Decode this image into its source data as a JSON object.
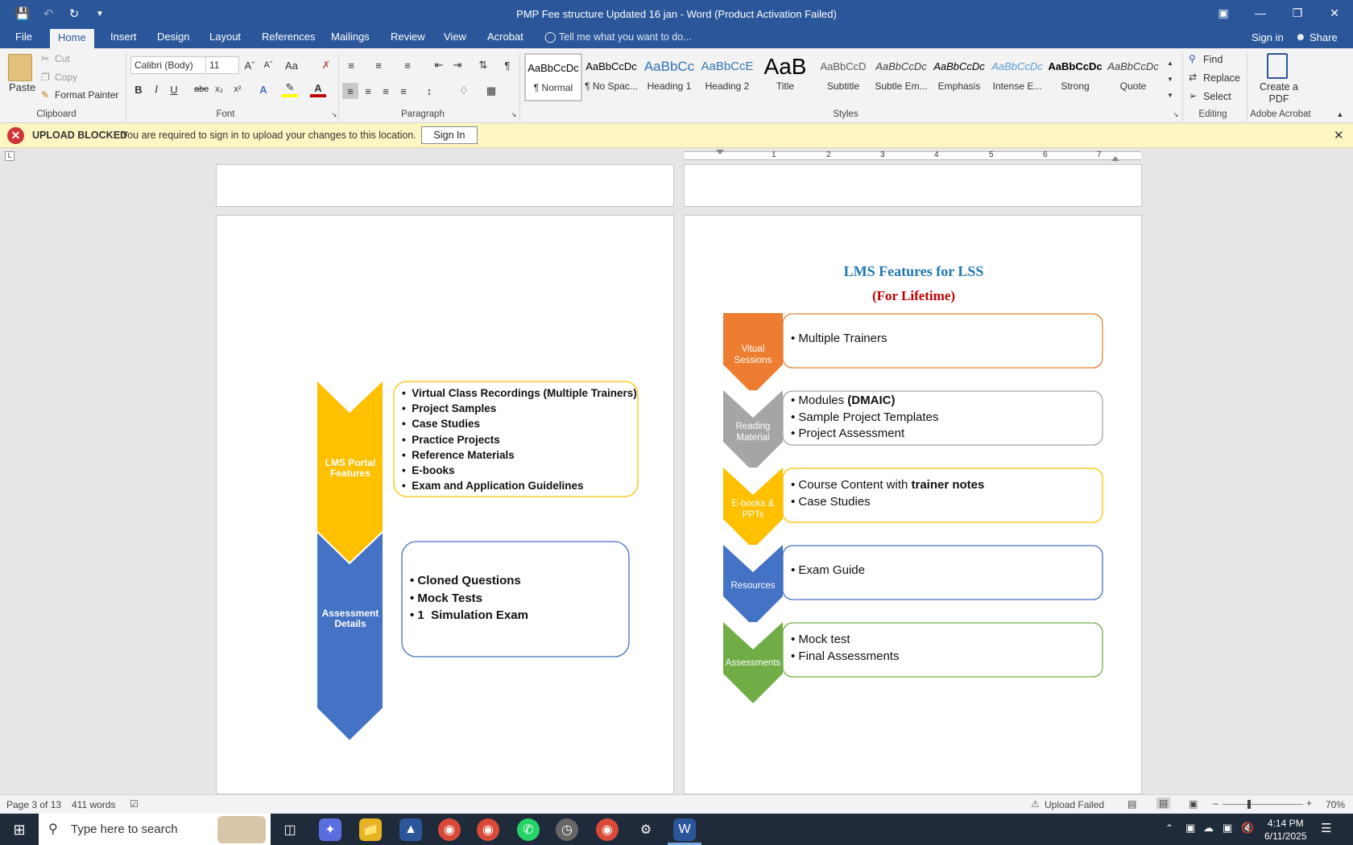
{
  "window": {
    "title": "PMP Fee structure Updated 16 jan  -  Word (Product Activation Failed)",
    "qat_icons": [
      "save-icon",
      "undo-icon",
      "redo-icon",
      "customize-icon"
    ],
    "controls": [
      "ribbon-display-icon",
      "minimize-icon",
      "restore-icon",
      "close-icon"
    ]
  },
  "tabs": {
    "items": [
      "File",
      "Home",
      "Insert",
      "Design",
      "Layout",
      "References",
      "Mailings",
      "Review",
      "View",
      "Acrobat"
    ],
    "active": "Home",
    "tell_me": "Tell me what you want to do...",
    "sign_in": "Sign in",
    "share": "Share"
  },
  "ribbon": {
    "clipboard": {
      "paste": "Paste",
      "cut": "Cut",
      "copy": "Copy",
      "format_painter": "Format Painter",
      "label": "Clipboard"
    },
    "font": {
      "name": "Calibri (Body)",
      "size": "11",
      "label": "Font"
    },
    "paragraph": {
      "label": "Paragraph"
    },
    "styles": {
      "label": "Styles",
      "items": [
        {
          "sample": "AaBbCcDc",
          "name": "¶ Normal"
        },
        {
          "sample": "AaBbCcDc",
          "name": "¶ No Spac..."
        },
        {
          "sample": "AaBbCc",
          "name": "Heading 1"
        },
        {
          "sample": "AaBbCcE",
          "name": "Heading 2"
        },
        {
          "sample": "AaB",
          "name": "Title"
        },
        {
          "sample": "AaBbCcD",
          "name": "Subtitle"
        },
        {
          "sample": "AaBbCcDc",
          "name": "Subtle Em..."
        },
        {
          "sample": "AaBbCcDc",
          "name": "Emphasis"
        },
        {
          "sample": "AaBbCcDc",
          "name": "Intense E..."
        },
        {
          "sample": "AaBbCcDc",
          "name": "Strong"
        },
        {
          "sample": "AaBbCcDc",
          "name": "Quote"
        }
      ]
    },
    "editing": {
      "find": "Find",
      "replace": "Replace",
      "select": "Select",
      "label": "Editing"
    },
    "acrobat": {
      "create_pdf": "Create a PDF",
      "label": "Adobe Acrobat"
    }
  },
  "message_bar": {
    "title": "UPLOAD BLOCKED",
    "text": "You are required to sign in to upload your changes to this location.",
    "button": "Sign In"
  },
  "ruler": {
    "numbers": [
      "1",
      "2",
      "3",
      "4",
      "5",
      "6",
      "7"
    ]
  },
  "left_diagram": {
    "top_box_label": "LMS Portal Features",
    "top_items": [
      "Virtual Class Recordings (Multiple Trainers)",
      "Project Samples",
      "Case Studies",
      "Practice Projects",
      "Reference Materials",
      "E-books",
      "Exam and Application Guidelines"
    ],
    "bottom_box_label": "Assessment Details",
    "bottom_items": [
      "Cloned Questions",
      "Mock Tests",
      "1  Simulation Exam"
    ],
    "colors": {
      "yellow": "#ffc000",
      "blue": "#4472c4"
    }
  },
  "right_page": {
    "title": "LMS Features for LSS",
    "subtitle": "(For Lifetime)",
    "rows": [
      {
        "label": "Vitual Sessions",
        "color": "#ed7d31",
        "items": [
          {
            "pre": "Multiple Trainers",
            "bold": ""
          }
        ]
      },
      {
        "label": "Reading Material",
        "color": "#a5a5a5",
        "items": [
          {
            "pre": "Modules ",
            "bold": "(DMAIC)"
          },
          {
            "pre": "Sample Project Templates",
            "bold": ""
          },
          {
            "pre": "Project Assessment",
            "bold": ""
          }
        ]
      },
      {
        "label": "E-books & PPTs",
        "color": "#ffc000",
        "items": [
          {
            "pre": "Course Content with ",
            "bold": "trainer notes"
          },
          {
            "pre": "Case Studies",
            "bold": ""
          }
        ]
      },
      {
        "label": "Resources",
        "color": "#4472c4",
        "items": [
          {
            "pre": "Exam Guide",
            "bold": ""
          }
        ]
      },
      {
        "label": "Assessments",
        "color": "#70ad47",
        "items": [
          {
            "pre": "Mock test",
            "bold": ""
          },
          {
            "pre": "Final Assessments",
            "bold": ""
          }
        ]
      }
    ]
  },
  "status_bar": {
    "page": "Page 3 of 13",
    "words": "411 words",
    "upload": "Upload Failed",
    "zoom": "70%"
  },
  "taskbar": {
    "search_placeholder": "Type here to search",
    "time": "4:14 PM",
    "date": "6/11/2025"
  }
}
